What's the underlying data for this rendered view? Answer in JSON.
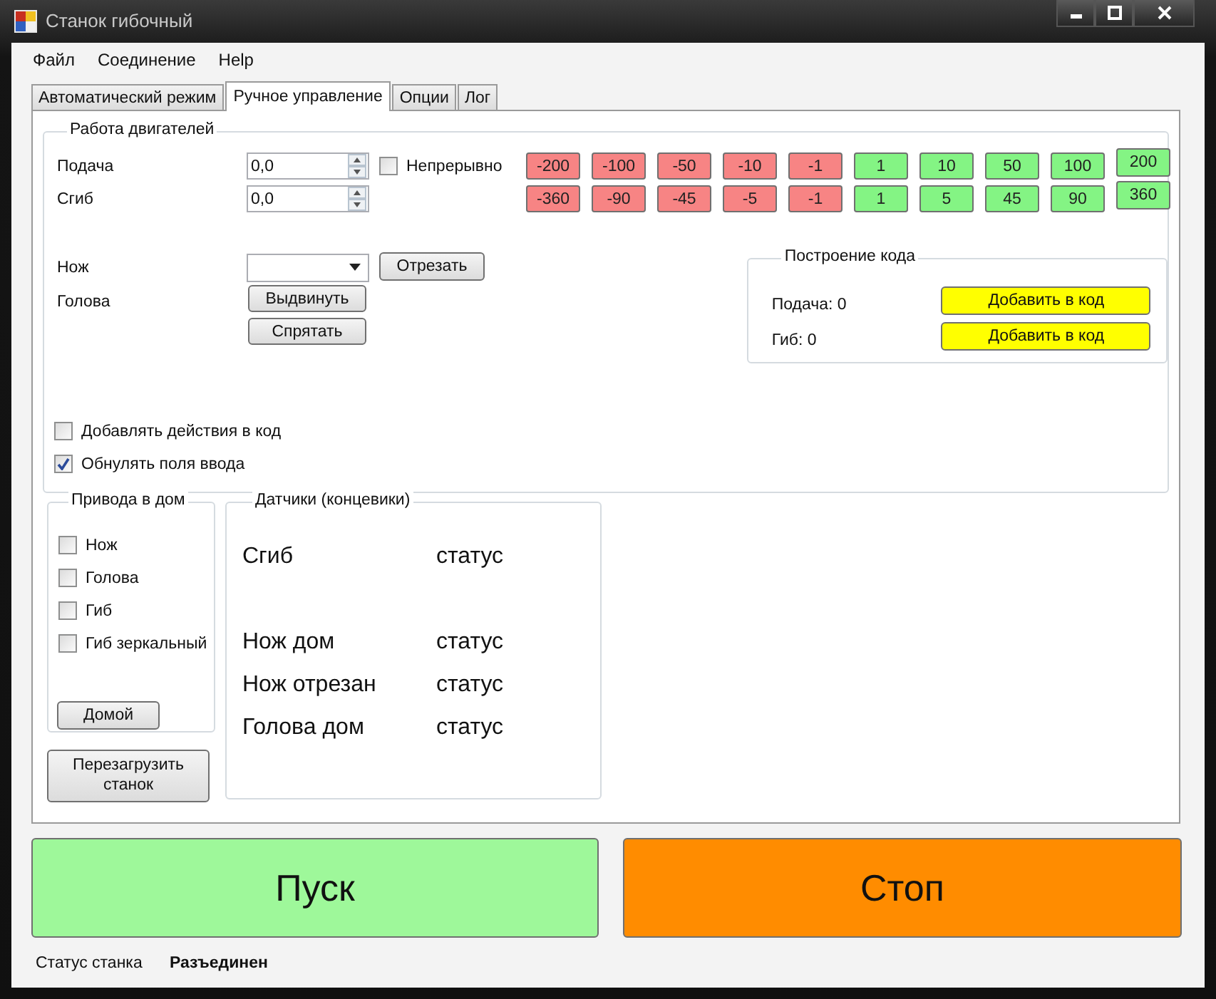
{
  "window": {
    "title": "Станок гибочный"
  },
  "menu": [
    "Файл",
    "Соединение",
    "Help"
  ],
  "tabs": [
    {
      "label": "Автоматический режим",
      "selected": false
    },
    {
      "label": "Ручное управление",
      "selected": true
    },
    {
      "label": "Опции",
      "selected": false
    },
    {
      "label": "Лог",
      "selected": false
    }
  ],
  "motors": {
    "title": "Работа двигателей",
    "axes": [
      {
        "label": "Подача",
        "value": "0,0",
        "continuous": {
          "label": "Непрерывно",
          "checked": false
        },
        "steps": [
          {
            "label": "-200",
            "kind": "negative"
          },
          {
            "label": "-100",
            "kind": "negative"
          },
          {
            "label": "-50",
            "kind": "negative"
          },
          {
            "label": "-10",
            "kind": "negative"
          },
          {
            "label": "-1",
            "kind": "negative"
          },
          {
            "label": "1",
            "kind": "positive"
          },
          {
            "label": "10",
            "kind": "positive"
          },
          {
            "label": "50",
            "kind": "positive"
          },
          {
            "label": "100",
            "kind": "positive"
          },
          {
            "label": "200",
            "kind": "positive"
          }
        ]
      },
      {
        "label": "Сгиб",
        "value": "0,0",
        "steps": [
          {
            "label": "-360",
            "kind": "negative"
          },
          {
            "label": "-90",
            "kind": "negative"
          },
          {
            "label": "-45",
            "kind": "negative"
          },
          {
            "label": "-5",
            "kind": "negative"
          },
          {
            "label": "-1",
            "kind": "negative"
          },
          {
            "label": "1",
            "kind": "positive"
          },
          {
            "label": "5",
            "kind": "positive"
          },
          {
            "label": "45",
            "kind": "positive"
          },
          {
            "label": "90",
            "kind": "positive"
          },
          {
            "label": "360",
            "kind": "positive"
          }
        ]
      }
    ],
    "knife": {
      "label": "Нож",
      "button": "Отрезать"
    },
    "head": {
      "label": "Голова",
      "buttons": [
        "Выдвинуть",
        "Спрятать"
      ]
    },
    "code_builder": {
      "title": "Построение кода",
      "rows": [
        {
          "label": "Подача: 0",
          "button": "Добавить в код"
        },
        {
          "label": "Гиб: 0",
          "button": "Добавить в код"
        }
      ]
    },
    "options": [
      {
        "label": "Добавлять действия в код",
        "checked": false
      },
      {
        "label": "Обнулять поля ввода",
        "checked": true
      }
    ]
  },
  "homing": {
    "title": "Привода в дом",
    "items": [
      {
        "label": "Нож",
        "checked": false
      },
      {
        "label": "Голова",
        "checked": false
      },
      {
        "label": "Гиб",
        "checked": false
      },
      {
        "label": "Гиб зеркальный",
        "checked": false
      }
    ],
    "button": "Домой"
  },
  "reload_button": "Перезагрузить станок",
  "sensors": {
    "title": "Датчики (концевики)",
    "rows": [
      {
        "name": "Сгиб",
        "status": "статус"
      },
      {
        "name": "Нож дом",
        "status": "статус"
      },
      {
        "name": "Нож отрезан",
        "status": "статус"
      },
      {
        "name": "Голова дом",
        "status": "статус"
      }
    ]
  },
  "start_button": "Пуск",
  "stop_button": "Стоп",
  "status_bar": {
    "label": "Статус станка",
    "value": "Разъединен"
  }
}
